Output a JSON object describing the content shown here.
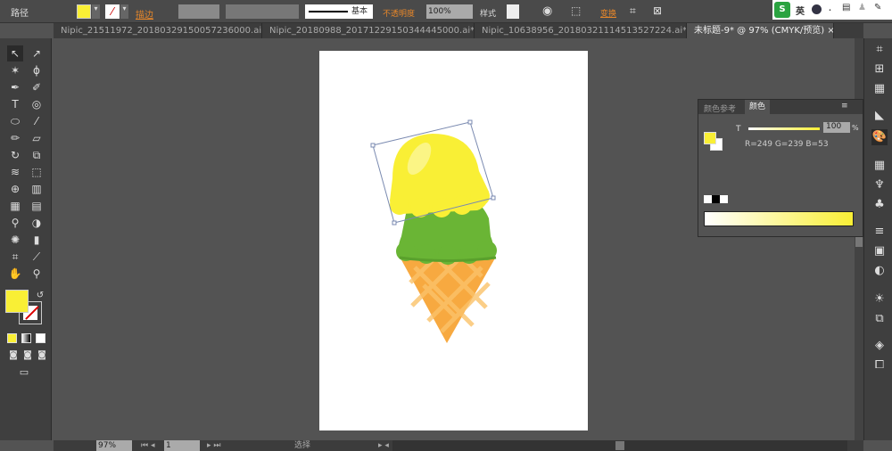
{
  "control_bar": {
    "object_type": "路径",
    "stroke_label": "描边",
    "stroke_style": "基本",
    "opacity_label": "不透明度",
    "opacity_value": "100%",
    "style_label": "样式",
    "transform_label": "变换",
    "fill_color": "#f9ef35"
  },
  "ime": {
    "label": "英"
  },
  "tabs": [
    {
      "label": "Nipic_21511972_20180329150057236000.ai* ...",
      "active": false
    },
    {
      "label": "Nipic_20180988_20171229150344445000.ai* ...",
      "active": false
    },
    {
      "label": "Nipic_10638956_20180321114513527224.ai* ...",
      "active": false
    },
    {
      "label": "未标题-9* @ 97% (CMYK/预览)",
      "active": true
    }
  ],
  "color_panel": {
    "tabs": [
      "颜色参考",
      "颜色"
    ],
    "active_tab": "颜色",
    "channel_label": "T",
    "tint_value": "100",
    "percent": "%",
    "rgb_readout": "R=249 G=239 B=53",
    "fill_color": "#f9ef35"
  },
  "status_bar": {
    "zoom": "97%",
    "page": "1",
    "tool": "选择"
  },
  "colors": {
    "yellow": "#f9ef35",
    "green": "#6ab535",
    "cone": "#f7a940"
  }
}
